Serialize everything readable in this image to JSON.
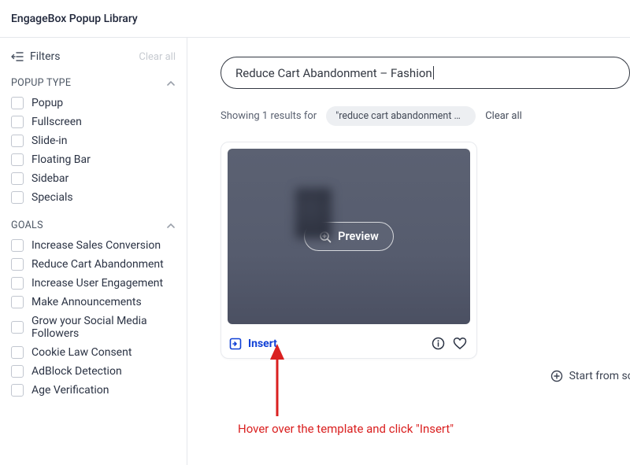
{
  "header": {
    "title": "EngageBox Popup Library"
  },
  "sidebar": {
    "filters_label": "Filters",
    "clear_label": "Clear all",
    "sections": {
      "popup_type": {
        "title": "POPUP TYPE",
        "items": [
          "Popup",
          "Fullscreen",
          "Slide-in",
          "Floating Bar",
          "Sidebar",
          "Specials"
        ]
      },
      "goals": {
        "title": "GOALS",
        "items": [
          "Increase Sales Conversion",
          "Reduce Cart Abandonment",
          "Increase User Engagement",
          "Make Announcements",
          "Grow your Social Media Followers",
          "Cookie Law Consent",
          "AdBlock Detection",
          "Age Verification"
        ]
      }
    }
  },
  "search": {
    "value": "Reduce Cart Abandonment – Fashion"
  },
  "results": {
    "showing_text": "Showing 1 results for",
    "chip_text": "\"reduce cart abandonment – fas…",
    "clear_label": "Clear all"
  },
  "card": {
    "preview_label": "Preview",
    "insert_label": "Insert"
  },
  "scratch": {
    "label": "Start from scratc"
  },
  "annotation": {
    "text": "Hover over the template and click \"Insert\""
  }
}
